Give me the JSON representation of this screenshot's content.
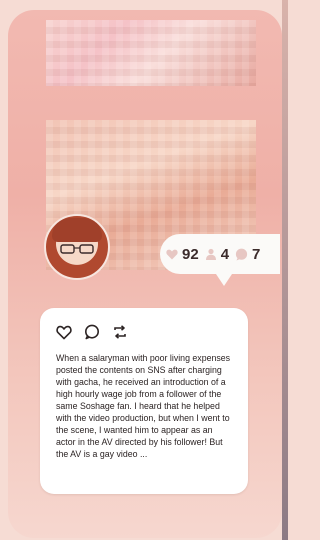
{
  "stats": {
    "likes": "92",
    "followers": "4",
    "comments": "7"
  },
  "post": {
    "description": "When a salaryman with poor living expenses posted the contents on SNS after charging with gacha, he received an introduction of a high hourly wage job from a follower of the same Soshage fan. I heard that he helped with the video production, but when I went to the scene, I wanted him to appear as an actor in the AV directed by his follower! But the AV is a gay video ..."
  },
  "icons": {
    "like": "heart-outline-icon",
    "comment": "comment-bubble-icon",
    "share": "repost-icon",
    "likes_stat": "heart-filled-icon",
    "followers_stat": "person-icon",
    "comments_stat": "comment-filled-icon"
  },
  "colors": {
    "background": "#f6dcd4",
    "phone": "#efb0a7",
    "card": "#ffffff",
    "text": "#2c2424"
  }
}
